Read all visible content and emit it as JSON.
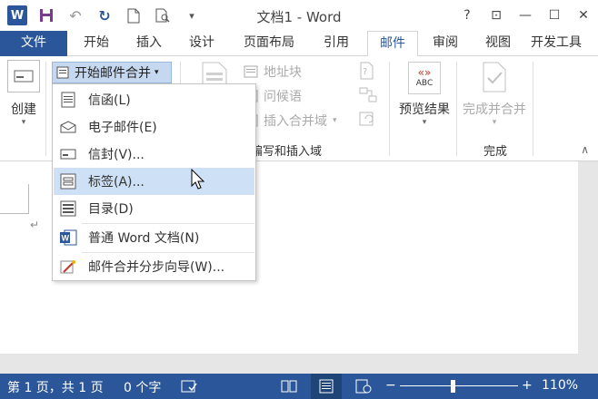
{
  "window": {
    "title": "文档1 - Word",
    "help": "?",
    "controls": {
      "restore_ribbon": "⊡",
      "minimize": "—",
      "maximize": "☐",
      "close": "✕"
    }
  },
  "quick_access": {
    "undo": "↶",
    "redo": "↻",
    "more": "▾"
  },
  "tabs": [
    {
      "label": "文件"
    },
    {
      "label": "开始"
    },
    {
      "label": "插入"
    },
    {
      "label": "设计"
    },
    {
      "label": "页面布局"
    },
    {
      "label": "引用"
    },
    {
      "label": "邮件"
    },
    {
      "label": "审阅"
    },
    {
      "label": "视图"
    },
    {
      "label": "开发工具"
    }
  ],
  "ribbon": {
    "create": {
      "label": "创建",
      "arrow": "▾"
    },
    "start_merge": {
      "label": "开始邮件合并",
      "arrow": "▾"
    },
    "address_block": "地址块",
    "greeting_line": "问候语",
    "insert_merge_field": "插入合并域",
    "insert_merge_field_arrow": "▾",
    "group_write_insert_label": "编写和插入域",
    "preview_results": {
      "label": "预览结果",
      "arrow": "▾",
      "icon_text": "ABC",
      "icon_marks": "«»"
    },
    "finish_merge": {
      "label": "完成并合并",
      "arrow": "▾"
    },
    "group_finish_label": "完成",
    "collapse": "∧"
  },
  "start_merge_menu": [
    {
      "label": "信函(L)",
      "icon": "letter-icon"
    },
    {
      "label": "电子邮件(E)",
      "icon": "email-icon"
    },
    {
      "label": "信封(V)...",
      "icon": "envelope-icon"
    },
    {
      "label": "标签(A)...",
      "icon": "labels-icon",
      "highlighted": true
    },
    {
      "label": "目录(D)",
      "icon": "directory-icon"
    },
    {
      "label": "普通 Word 文档(N)",
      "icon": "word-doc-icon"
    },
    {
      "label": "邮件合并分步向导(W)...",
      "icon": "wizard-icon"
    }
  ],
  "document": {
    "paragraph_mark": "↵"
  },
  "statusbar": {
    "page": "第 1 页，共 1 页",
    "words": "0 个字",
    "zoom_minus": "−",
    "zoom_plus": "+",
    "zoom": "110%",
    "zoom_fraction": 0.45
  },
  "colors": {
    "accent": "#2b579a",
    "menu_highlight": "#cde0f5",
    "button_highlight": "#c5d8f0"
  }
}
